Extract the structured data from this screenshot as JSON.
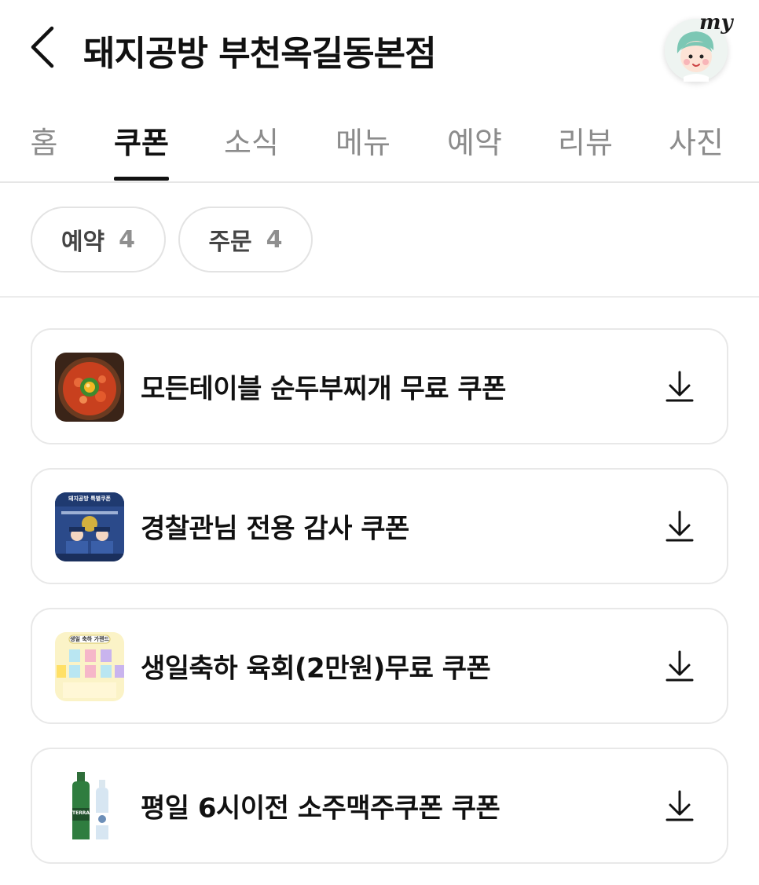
{
  "header": {
    "title": "돼지공방 부천옥길동본점",
    "avatar_text": "my"
  },
  "tabs": [
    {
      "label": "홈",
      "active": false
    },
    {
      "label": "쿠폰",
      "active": true
    },
    {
      "label": "소식",
      "active": false
    },
    {
      "label": "메뉴",
      "active": false
    },
    {
      "label": "예약",
      "active": false
    },
    {
      "label": "리뷰",
      "active": false
    },
    {
      "label": "사진",
      "active": false
    }
  ],
  "filters": [
    {
      "label": "예약",
      "count": "4"
    },
    {
      "label": "주문",
      "count": "4"
    }
  ],
  "coupons": [
    {
      "title": "모든테이블 순두부찌개 무료 쿠폰",
      "thumb": "soondubu-stew-image"
    },
    {
      "title": "경찰관님 전용 감사 쿠폰",
      "thumb": "police-coupon-image",
      "thumb_text": "돼지공방 특별쿠폰"
    },
    {
      "title": "생일축하 육회(2만원)무료 쿠폰",
      "thumb": "birthday-coupon-image",
      "thumb_text": "생일 축하 가랜드"
    },
    {
      "title": "평일 6시이전 소주맥주쿠폰 쿠폰",
      "thumb": "soju-beer-image",
      "thumb_text": "TERRA"
    }
  ],
  "colors": {
    "active_tab": "#111111",
    "inactive_tab": "#8c8c8c",
    "border": "#e8e8e8"
  },
  "icons": {
    "back": "chevron-left-icon",
    "download": "download-icon"
  }
}
